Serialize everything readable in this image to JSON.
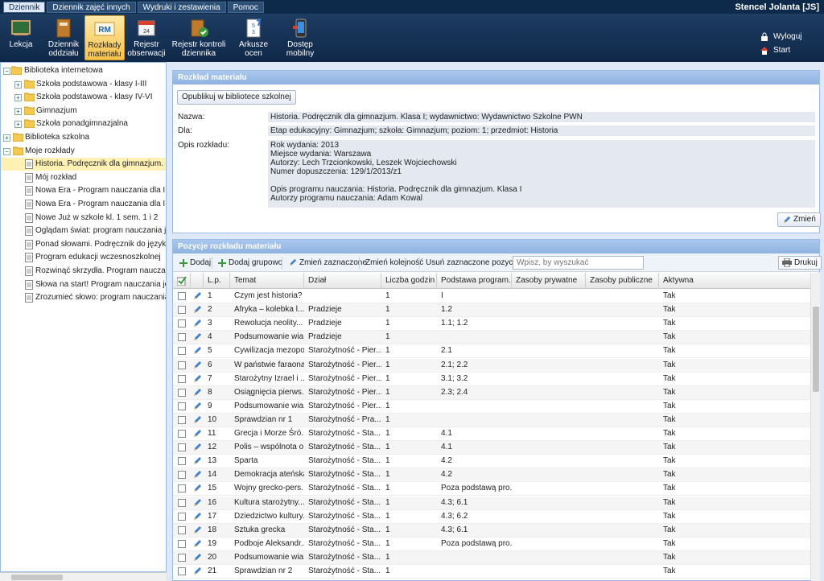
{
  "menu": {
    "tabs": [
      "Dziennik",
      "Dziennik zajęć innych",
      "Wydruki i zestawienia",
      "Pomoc"
    ]
  },
  "user": {
    "name": "Stencel Jolanta [JS]",
    "logout": "Wyloguj",
    "start": "Start"
  },
  "toolbar": {
    "buttons": [
      {
        "label": "Lekcja",
        "icon": "blackboard-icon"
      },
      {
        "label": "Dziennik oddziału",
        "icon": "journal-icon"
      },
      {
        "label": "Rozkłady materiału",
        "icon": "rm-icon"
      },
      {
        "label": "Rejestr obserwacji",
        "icon": "register-icon"
      },
      {
        "label": "Rejestr kontroli dziennika",
        "icon": "control-icon"
      },
      {
        "label": "Arkusze ocen",
        "icon": "grades-sheet-icon"
      },
      {
        "label": "Dostęp mobilny",
        "icon": "mobile-icon"
      }
    ]
  },
  "tree": {
    "items": [
      {
        "label": "Biblioteka internetowa",
        "type": "folder"
      },
      {
        "label": "Szkoła podstawowa - klasy I-III",
        "type": "folder"
      },
      {
        "label": "Szkoła podstawowa - klasy IV-VI",
        "type": "folder"
      },
      {
        "label": "Gimnazjum",
        "type": "folder"
      },
      {
        "label": "Szkoła ponadgimnazjalna",
        "type": "folder"
      },
      {
        "label": "Biblioteka szkolna",
        "type": "folder"
      },
      {
        "label": "Moje rozkłady",
        "type": "folder"
      },
      {
        "label": "Historia. Podręcznik dla gimnazjum. Klasa I",
        "type": "doc"
      },
      {
        "label": "Mój rozkład",
        "type": "doc"
      },
      {
        "label": "Nowa Era - Program nauczania dla I etapu",
        "type": "doc"
      },
      {
        "label": "Nowa Era - Program nauczania dla I etapu",
        "type": "doc"
      },
      {
        "label": "Nowe Już w szkole kl. 1 sem. 1 i 2",
        "type": "doc"
      },
      {
        "label": "Oglądam świat: program nauczania języka",
        "type": "doc"
      },
      {
        "label": "Ponad słowami. Podręcznik do języka polskiego",
        "type": "doc"
      },
      {
        "label": "Program edukacji wczesnoszkolnej",
        "type": "doc"
      },
      {
        "label": "Rozwinąć skrzydła. Program nauczania języka",
        "type": "doc"
      },
      {
        "label": "Słowa na start! Program nauczania języka",
        "type": "doc"
      },
      {
        "label": "Zrozumieć słowo: program nauczania języka",
        "type": "doc"
      }
    ]
  },
  "details": {
    "title": "Rozkład materiału",
    "publish_button": "Opublikuj w bibliotece szkolnej",
    "name_label": "Nazwa:",
    "name_value": "Historia. Podręcznik dla gimnazjum. Klasa I; wydawnictwo: Wydawnictwo Szkolne PWN",
    "for_label": "Dla:",
    "for_value": "Etap edukacyjny: Gimnazjum; szkoła: Gimnazjum; poziom: 1; przedmiot: Historia",
    "desc_label": "Opis rozkładu:",
    "desc_lines": [
      "Rok wydania: 2013",
      "Miejsce wydania: Warszawa",
      "Autorzy: Lech Trzcionkowski, Leszek Wojciechowski",
      "Numer dopuszczenia: 129/1/2013/z1",
      "",
      "Opis programu nauczania: Historia. Podręcznik dla gimnazjum. Klasa I",
      "Autorzy programu nauczania: Adam Kowal"
    ],
    "edit_button": "Zmień"
  },
  "positions": {
    "title": "Pozycje rozkładu materiału",
    "toolbar": {
      "add": "Dodaj",
      "add_group": "Dodaj grupowo",
      "edit_selected": "Zmień zaznaczone",
      "reorder": "Zmień kolejność",
      "delete_selected": "Usuń zaznaczone pozycje",
      "search_placeholder": "Wpisz, by wyszukać",
      "print": "Drukuj"
    },
    "columns": [
      "L.p.",
      "Temat",
      "Dział",
      "Liczba godzin",
      "Podstawa program...",
      "Zasoby prywatne",
      "Zasoby publiczne",
      "Aktywna"
    ],
    "rows": [
      {
        "lp": "1",
        "temat": "Czym jest historia?",
        "dzial": "",
        "godz": "1",
        "podstawa": "I",
        "akt": "Tak"
      },
      {
        "lp": "2",
        "temat": "Afryka – kolebka l...",
        "dzial": "Pradzieje",
        "godz": "1",
        "podstawa": "1.2",
        "akt": "Tak"
      },
      {
        "lp": "3",
        "temat": "Rewolucja neolity...",
        "dzial": "Pradzieje",
        "godz": "1",
        "podstawa": "1.1; 1.2",
        "akt": "Tak"
      },
      {
        "lp": "4",
        "temat": "Podsumowanie wia...",
        "dzial": "Pradzieje",
        "godz": "1",
        "podstawa": "",
        "akt": "Tak"
      },
      {
        "lp": "5",
        "temat": "Cywilizacja mezopo...",
        "dzial": "Starożytność - Pier...",
        "godz": "1",
        "podstawa": "2.1",
        "akt": "Tak"
      },
      {
        "lp": "6",
        "temat": "W państwie faraona",
        "dzial": "Starożytność - Pier...",
        "godz": "1",
        "podstawa": "2.1; 2.2",
        "akt": "Tak"
      },
      {
        "lp": "7",
        "temat": "Starożytny Izrael i ...",
        "dzial": "Starożytność - Pier...",
        "godz": "1",
        "podstawa": "3.1; 3.2",
        "akt": "Tak"
      },
      {
        "lp": "8",
        "temat": "Osiągnięcia pierws...",
        "dzial": "Starożytność - Pier...",
        "godz": "1",
        "podstawa": "2.3; 2.4",
        "akt": "Tak"
      },
      {
        "lp": "9",
        "temat": "Podsumowanie wia...",
        "dzial": "Starożytność - Pier...",
        "godz": "1",
        "podstawa": "",
        "akt": "Tak"
      },
      {
        "lp": "10",
        "temat": "Sprawdzian nr 1",
        "dzial": "Starożytność - Pra...",
        "godz": "1",
        "podstawa": "",
        "akt": "Tak"
      },
      {
        "lp": "11",
        "temat": "Grecja i Morze Śró...",
        "dzial": "Starożytność - Sta...",
        "godz": "1",
        "podstawa": "4.1",
        "akt": "Tak"
      },
      {
        "lp": "12",
        "temat": "Polis – wspólnota o...",
        "dzial": "Starożytność - Sta...",
        "godz": "1",
        "podstawa": "4.1",
        "akt": "Tak"
      },
      {
        "lp": "13",
        "temat": "Sparta",
        "dzial": "Starożytność - Sta...",
        "godz": "1",
        "podstawa": "4.2",
        "akt": "Tak"
      },
      {
        "lp": "14",
        "temat": "Demokracja ateńska",
        "dzial": "Starożytność - Sta...",
        "godz": "1",
        "podstawa": "4.2",
        "akt": "Tak"
      },
      {
        "lp": "15",
        "temat": "Wojny grecko-pers...",
        "dzial": "Starożytność - Sta...",
        "godz": "1",
        "podstawa": "Poza podstawą pro...",
        "akt": "Tak"
      },
      {
        "lp": "16",
        "temat": "Kultura starożytny...",
        "dzial": "Starożytność - Sta...",
        "godz": "1",
        "podstawa": "4.3; 6.1",
        "akt": "Tak"
      },
      {
        "lp": "17",
        "temat": "Dziedzictwo kultury...",
        "dzial": "Starożytność - Sta...",
        "godz": "1",
        "podstawa": "4.3; 6.2",
        "akt": "Tak"
      },
      {
        "lp": "18",
        "temat": "Sztuka grecka",
        "dzial": "Starożytność - Sta...",
        "godz": "1",
        "podstawa": "4.3; 6.1",
        "akt": "Tak"
      },
      {
        "lp": "19",
        "temat": "Podboje Aleksandr...",
        "dzial": "Starożytność - Sta...",
        "godz": "1",
        "podstawa": "Poza podstawą pro...",
        "akt": "Tak"
      },
      {
        "lp": "20",
        "temat": "Podsumowanie wia...",
        "dzial": "Starożytność - Sta...",
        "godz": "1",
        "podstawa": "",
        "akt": "Tak"
      },
      {
        "lp": "21",
        "temat": "Sprawdzian nr 2",
        "dzial": "Starożytność - Sta...",
        "godz": "1",
        "podstawa": "",
        "akt": "Tak"
      }
    ]
  }
}
